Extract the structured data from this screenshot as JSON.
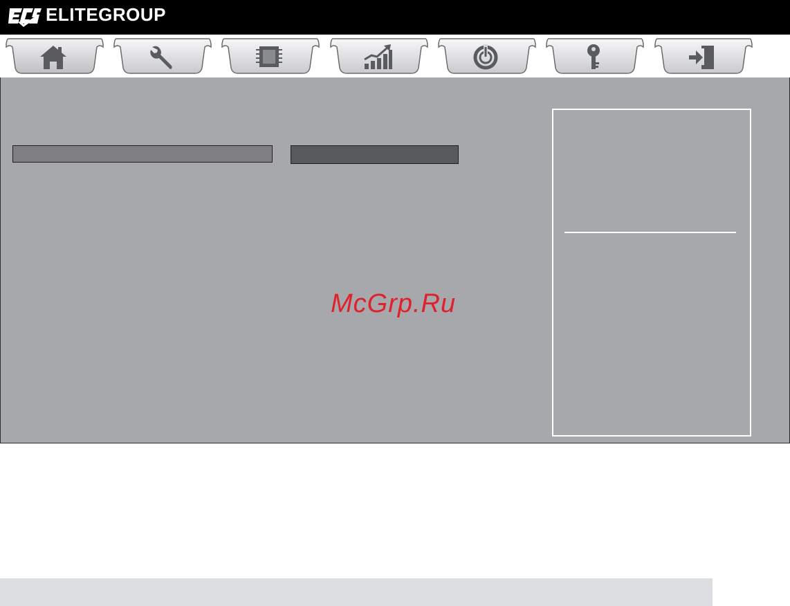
{
  "header": {
    "brand": "ELITEGROUP",
    "logo_icon": "ecs-logo-icon"
  },
  "tabs": [
    {
      "id": "main",
      "icon": "home-icon",
      "active": true
    },
    {
      "id": "advanced",
      "icon": "wrench-icon",
      "active": false
    },
    {
      "id": "chipset",
      "icon": "chip-icon",
      "active": false
    },
    {
      "id": "mib",
      "icon": "chart-up-icon",
      "active": false
    },
    {
      "id": "boot",
      "icon": "power-icon",
      "active": false
    },
    {
      "id": "security",
      "icon": "key-icon",
      "active": false
    },
    {
      "id": "exit",
      "icon": "exit-door-icon",
      "active": false
    }
  ],
  "watermark": "McGrp.Ru",
  "colors": {
    "header_bg": "#000000",
    "panel_bg": "#a7a8ab",
    "tab_face": "#d9d9dc",
    "tab_face_active": "#c7c8cb",
    "icon": "#5a5b5e",
    "watermark": "#e0202a"
  }
}
